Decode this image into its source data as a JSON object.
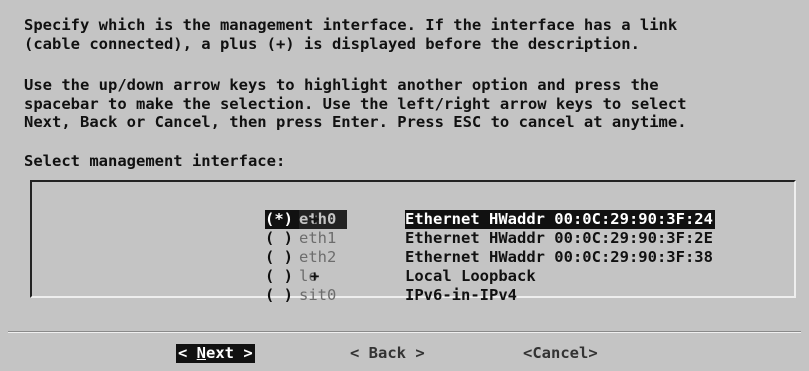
{
  "instructions": {
    "paragraph1_line1": "Specify which is the management interface. If the interface has a link",
    "paragraph1_line2": "(cable connected), a plus (+) is displayed before the description.",
    "paragraph2_line1": "Use the up/down arrow keys to highlight another option and press the",
    "paragraph2_line2": "spacebar to make the selection. Use the left/right arrow keys to select",
    "paragraph2_line3": "Next, Back or Cancel, then press Enter. Press ESC to cancel at anytime."
  },
  "select_label": "Select management interface:",
  "options": [
    {
      "radio": "(*)",
      "device": "eth0",
      "link": "+",
      "description": "Ethernet HWaddr 00:0C:29:90:3F:24",
      "selected": true
    },
    {
      "radio": "( )",
      "device": "eth1",
      "link": "",
      "description": "Ethernet HWaddr 00:0C:29:90:3F:2E",
      "selected": false
    },
    {
      "radio": "( )",
      "device": "eth2",
      "link": "",
      "description": "Ethernet HWaddr 00:0C:29:90:3F:38",
      "selected": false
    },
    {
      "radio": "( )",
      "device": "lo",
      "link": "+",
      "description": "Local Loopback",
      "selected": false
    },
    {
      "radio": "( )",
      "device": "sit0",
      "link": "",
      "description": "IPv6-in-IPv4",
      "selected": false
    }
  ],
  "buttons": {
    "next_prefix": "< ",
    "next_hotkey": "N",
    "next_rest": "ext >",
    "back": "< Back >",
    "cancel": "<Cancel>"
  }
}
